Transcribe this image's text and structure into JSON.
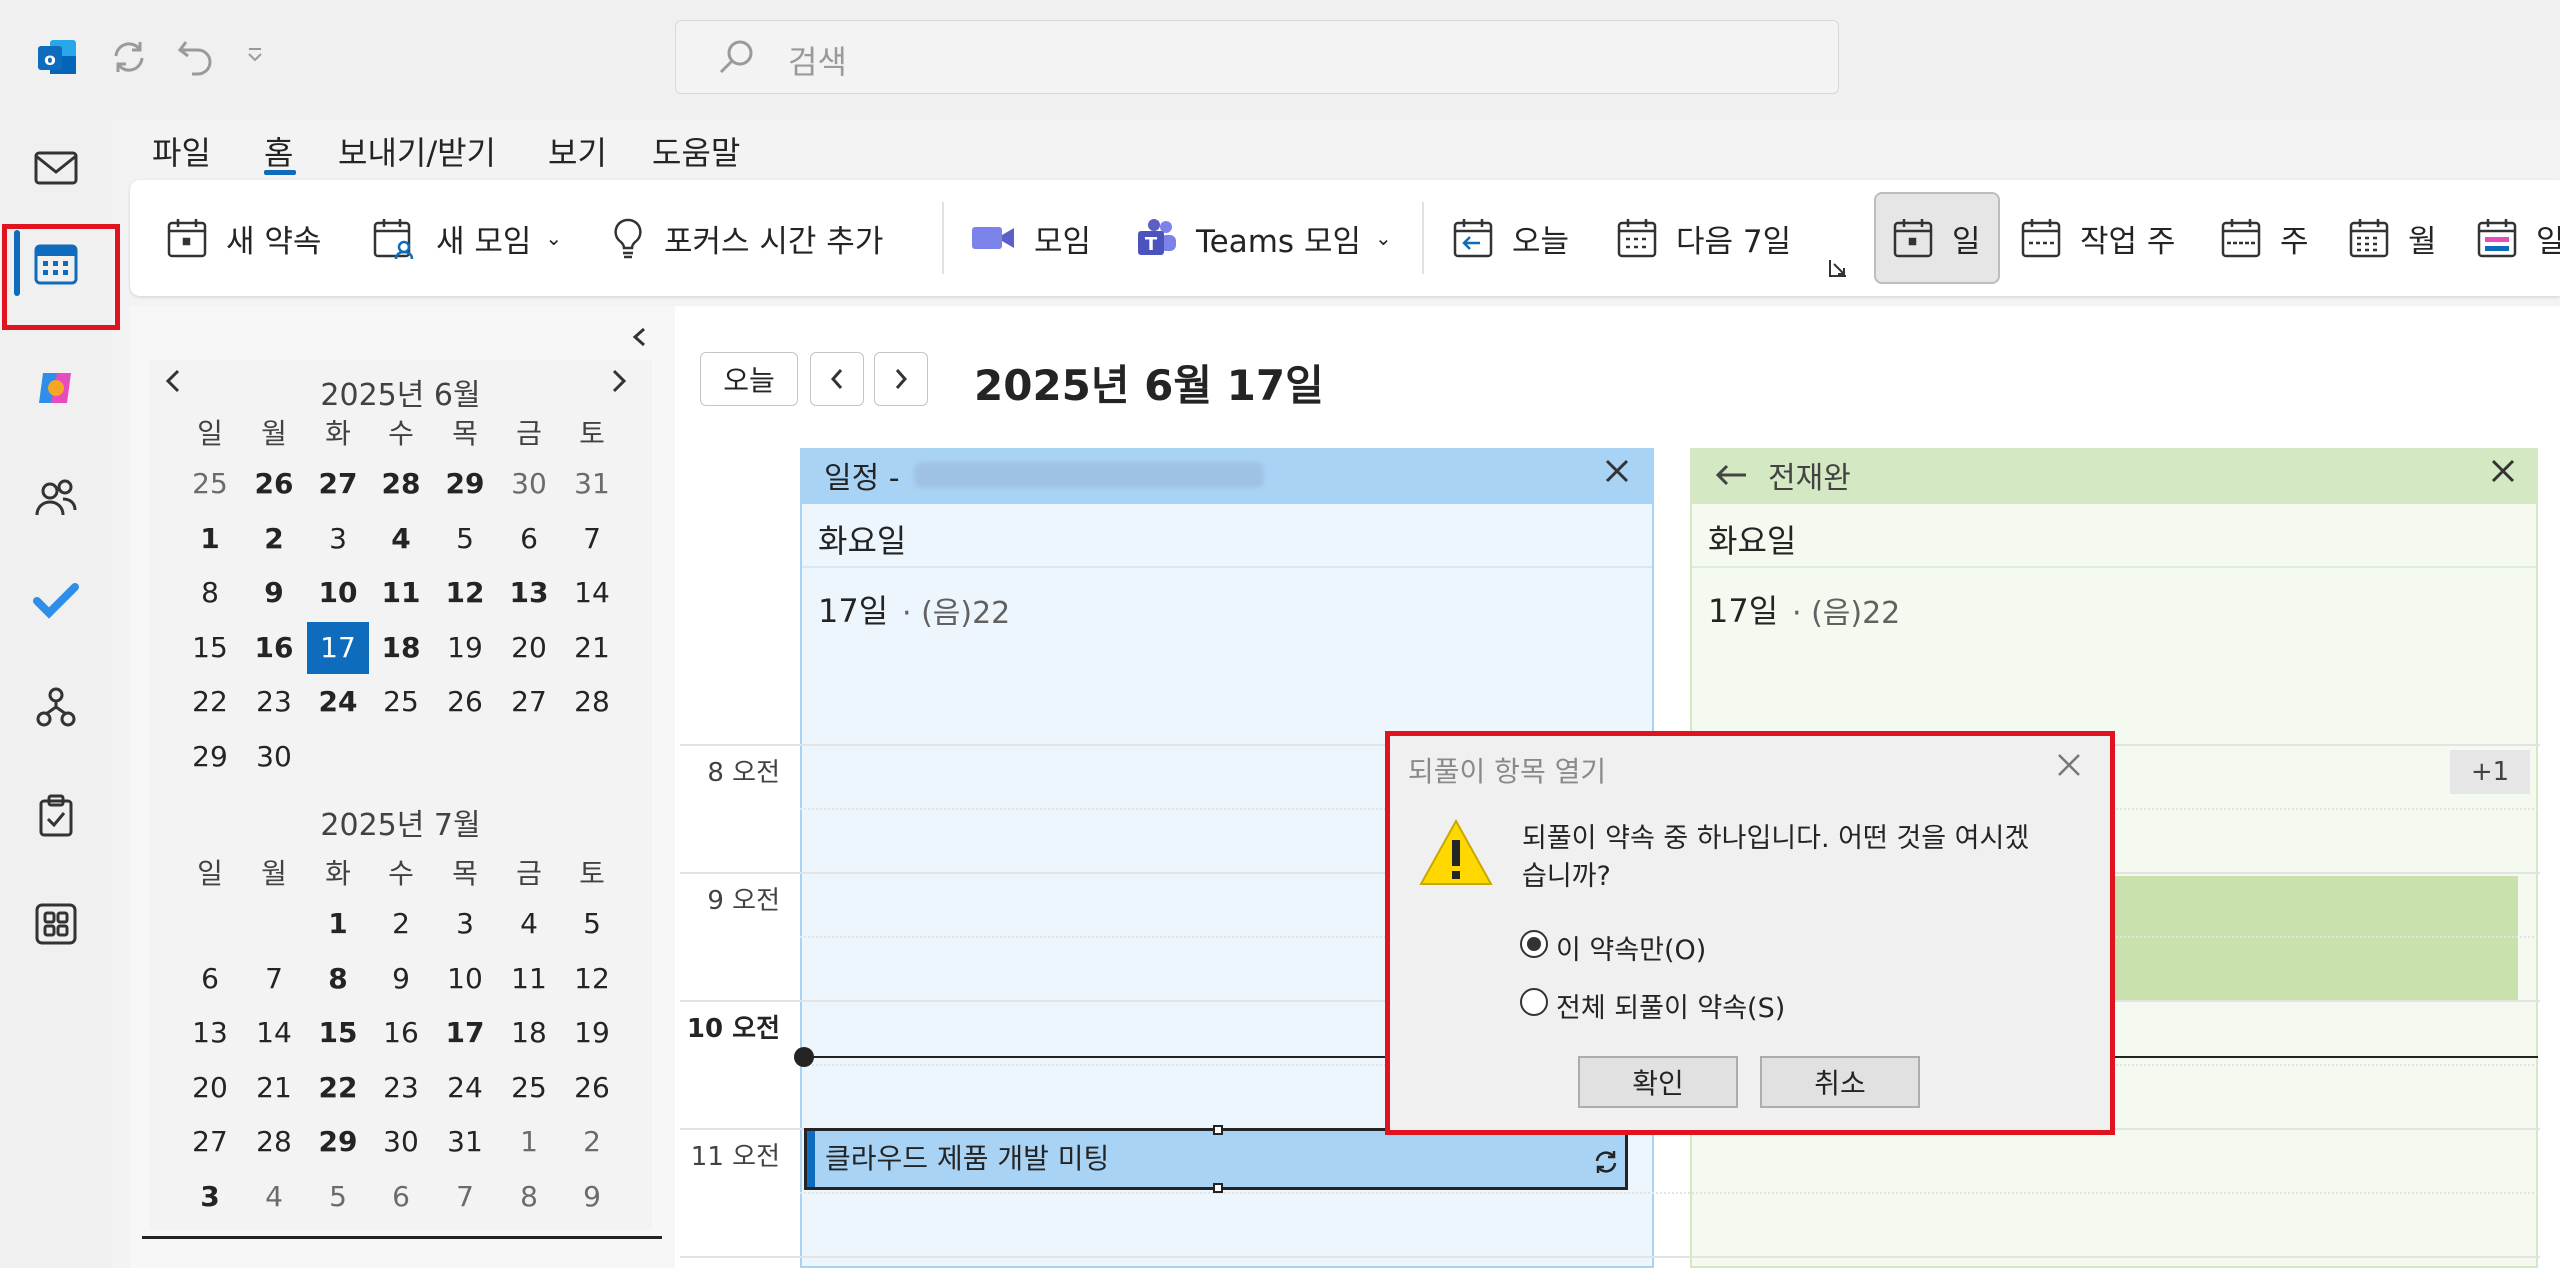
{
  "search": {
    "placeholder": "검색"
  },
  "menu": [
    "파일",
    "홈",
    "보내기/받기",
    "보기",
    "도움말"
  ],
  "ribbon": {
    "new_appointment": "새 약속",
    "new_meeting": "새 모임",
    "focus_time": "포커스 시간 추가",
    "meeting": "모임",
    "teams_meeting": "Teams 모임",
    "today": "오늘",
    "next7": "다음 7일",
    "day": "일",
    "work_week": "작업 주",
    "week": "주",
    "month": "월",
    "schedule": "일"
  },
  "mini_cal": {
    "june_title": "2025년 6월",
    "july_title": "2025년 7월",
    "weekdays": [
      "일",
      "월",
      "화",
      "수",
      "목",
      "금",
      "토"
    ],
    "june_weeks": [
      [
        "25",
        "26",
        "27",
        "28",
        "29",
        "30",
        "31"
      ],
      [
        "1",
        "2",
        "3",
        "4",
        "5",
        "6",
        "7"
      ],
      [
        "8",
        "9",
        "10",
        "11",
        "12",
        "13",
        "14"
      ],
      [
        "15",
        "16",
        "17",
        "18",
        "19",
        "20",
        "21"
      ],
      [
        "22",
        "23",
        "24",
        "25",
        "26",
        "27",
        "28"
      ],
      [
        "29",
        "30",
        "",
        "",
        "",
        "",
        ""
      ]
    ],
    "july_weeks": [
      [
        "",
        "",
        "1",
        "2",
        "3",
        "4",
        "5"
      ],
      [
        "6",
        "7",
        "8",
        "9",
        "10",
        "11",
        "12"
      ],
      [
        "13",
        "14",
        "15",
        "16",
        "17",
        "18",
        "19"
      ],
      [
        "20",
        "21",
        "22",
        "23",
        "24",
        "25",
        "26"
      ],
      [
        "27",
        "28",
        "29",
        "30",
        "31",
        "1",
        "2"
      ],
      [
        "3",
        "4",
        "5",
        "6",
        "7",
        "8",
        "9"
      ]
    ]
  },
  "toolbar": {
    "today_btn": "오늘"
  },
  "date_header": "2025년 6월 17일",
  "columns": {
    "left": {
      "header": "일정 -",
      "weekday": "화요일",
      "day": "17일",
      "lunar": "· (음)22"
    },
    "right": {
      "header": "전재완",
      "weekday": "화요일",
      "day": "17일",
      "lunar": "· (음)22",
      "more": "+1"
    }
  },
  "hours": [
    "8 오전",
    "9 오전",
    "10 오전",
    "11 오전"
  ],
  "event": {
    "title": "클라우드 제품 개발 미팅"
  },
  "dialog": {
    "title": "되풀이 항목 열기",
    "message_line1": "되풀이 약속 중 하나입니다. 어떤 것을 여시겠",
    "message_line2": "습니까?",
    "option1": "이 약속만(O)",
    "option2": "전체 되풀이 약속(S)",
    "ok": "확인",
    "cancel": "취소"
  },
  "colors": {
    "accent": "#0f6cbd",
    "highlight_red": "#e0141e",
    "calendar_blue": "#a9d3f5",
    "calendar_green": "#d5e8c4"
  }
}
